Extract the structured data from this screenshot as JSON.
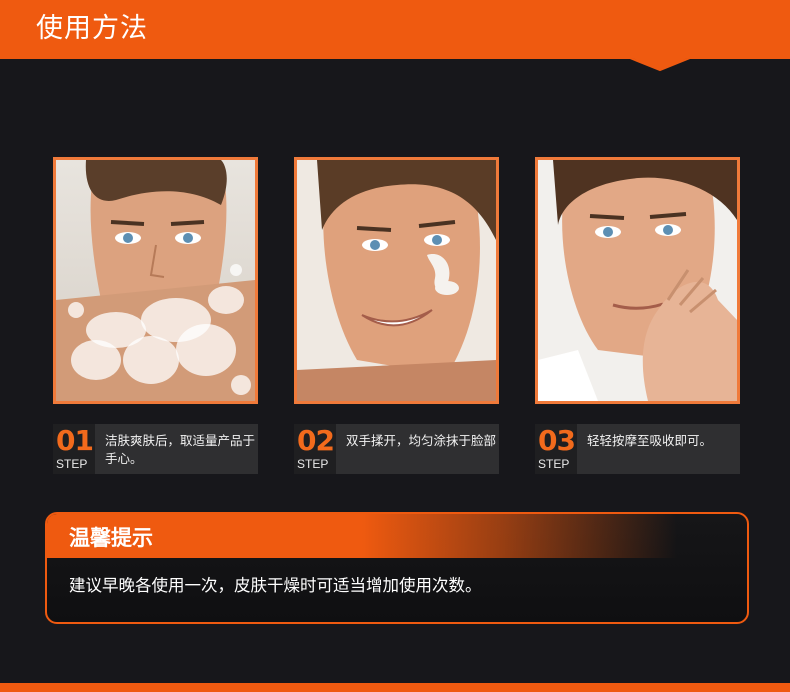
{
  "header": {
    "title": "使用方法"
  },
  "steps": [
    {
      "num": "01",
      "word": "STEP",
      "text": "洁肤爽肤后，取适量产品于手心。",
      "image": "man-face-water-splash"
    },
    {
      "num": "02",
      "word": "STEP",
      "text": "双手揉开，均匀涂抹于脸部",
      "image": "man-face-cream-on-cheek"
    },
    {
      "num": "03",
      "word": "STEP",
      "text": "轻轻按摩至吸收即可。",
      "image": "man-touching-chin"
    }
  ],
  "tip": {
    "title": "温馨提示",
    "body": "建议早晚各使用一次，皮肤干燥时可适当增加使用次数。"
  },
  "colors": {
    "accent": "#ef5a10",
    "background": "#17171b",
    "step_box": "#2f2f31"
  }
}
